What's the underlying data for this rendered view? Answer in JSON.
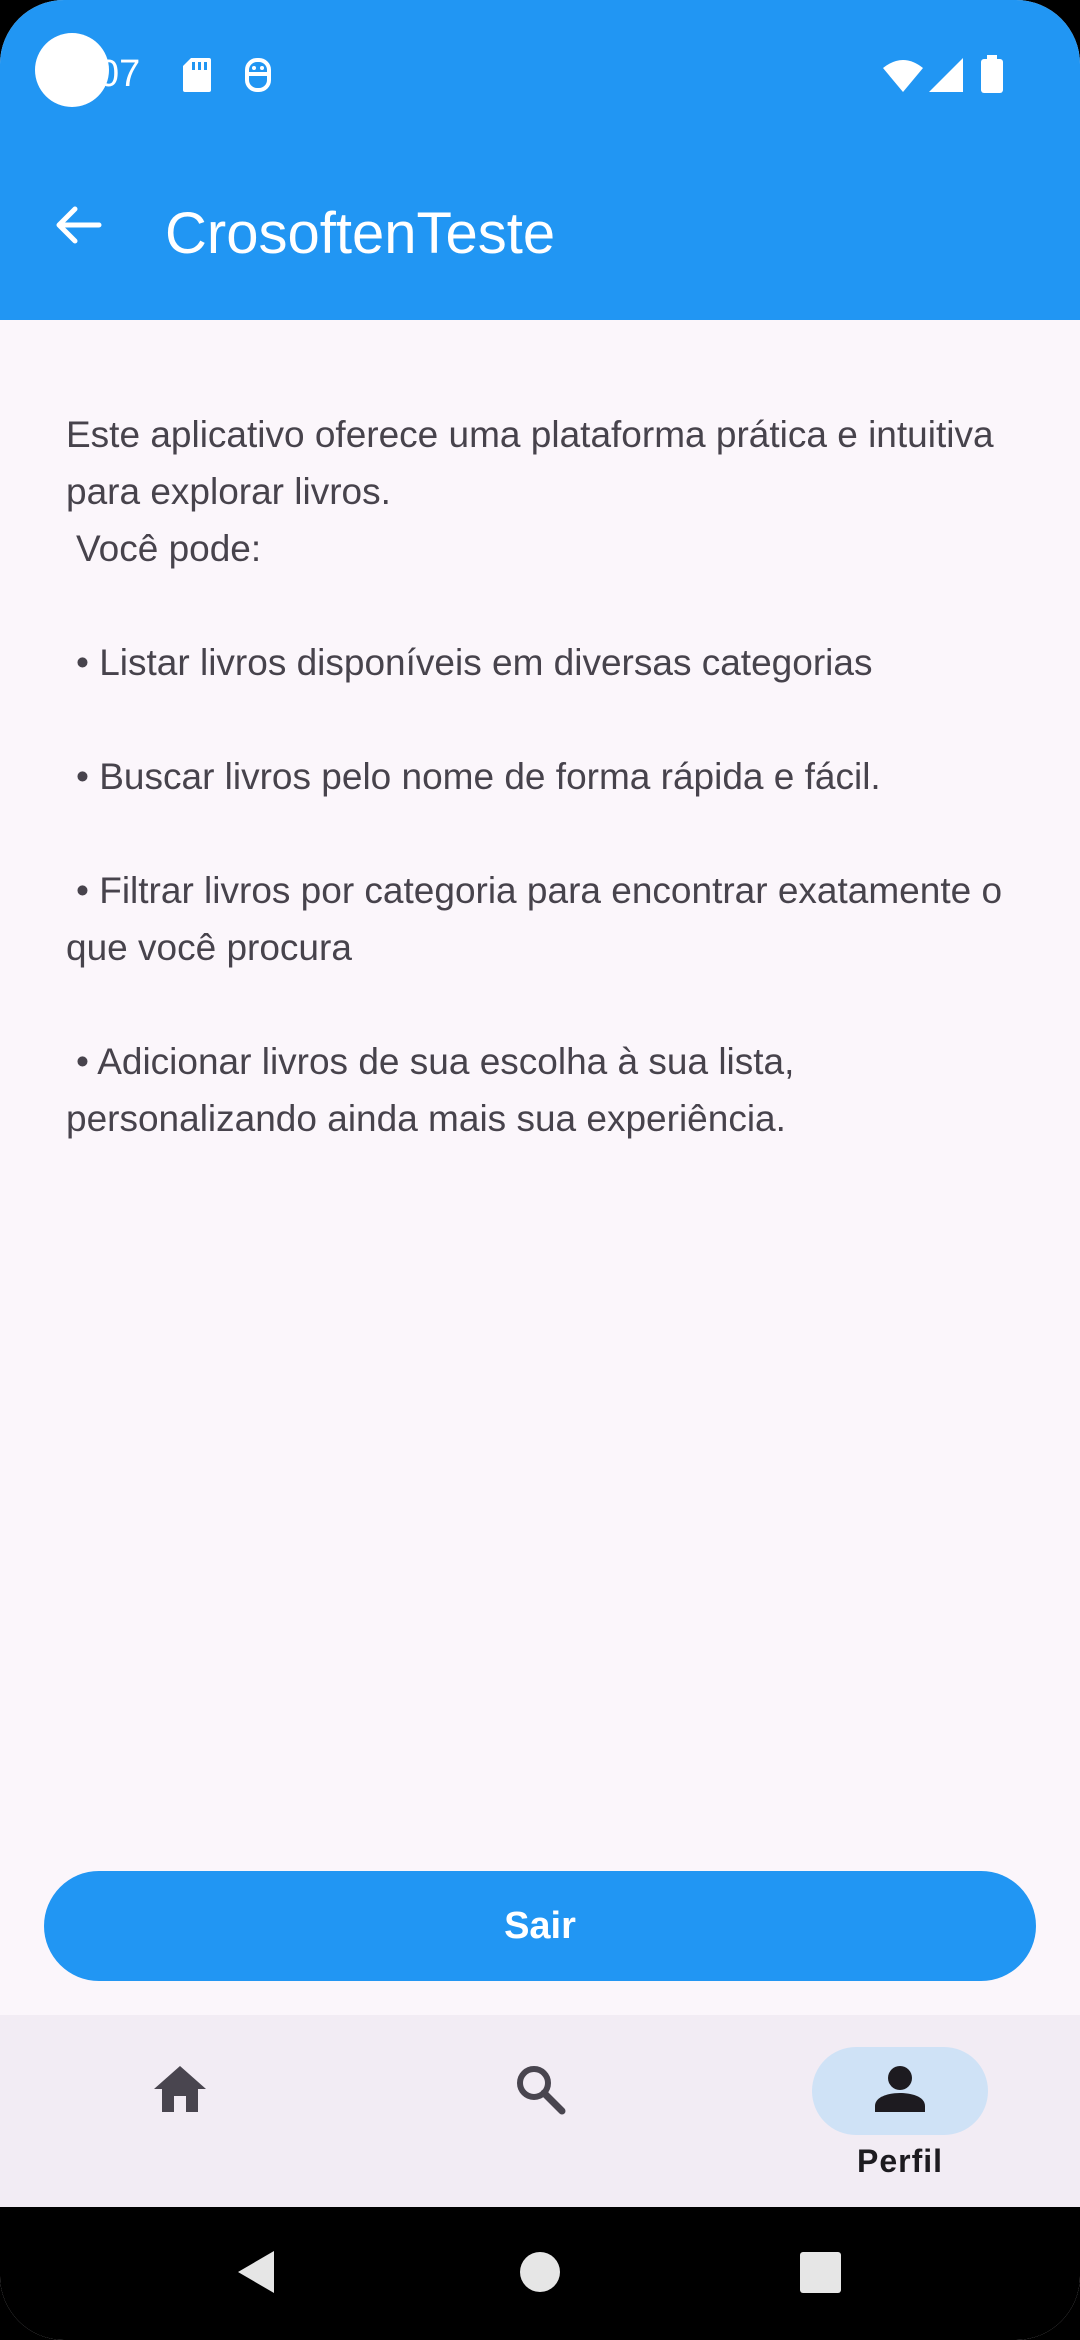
{
  "status_bar": {
    "time": "07",
    "icons": [
      "sd-card-icon",
      "android-debug-icon",
      "wifi-icon",
      "signal-icon",
      "battery-icon"
    ]
  },
  "app_bar": {
    "title": "CrosoftenTeste",
    "back_icon": "arrow-back-icon"
  },
  "content": {
    "intro_line1": "Este aplicativo oferece uma plataforma prática e intuitiva para explorar livros.",
    "intro_line2": "Você pode:",
    "features": [
      "• Listar livros disponíveis em diversas categorias",
      "• Buscar livros pelo nome de forma rápida e fácil.",
      "• Filtrar livros por categoria para encontrar exatamente o que você procura",
      "• Adicionar livros de sua escolha à sua lista, personalizando ainda mais sua experiência."
    ]
  },
  "actions": {
    "logout_label": "Sair"
  },
  "bottom_nav": {
    "items": [
      {
        "icon": "home-icon",
        "label": "",
        "active": false
      },
      {
        "icon": "search-icon",
        "label": "",
        "active": false
      },
      {
        "icon": "person-icon",
        "label": "Perfil",
        "active": true
      }
    ]
  },
  "system_nav": [
    "back-triangle-icon",
    "home-circle-icon",
    "recents-square-icon"
  ],
  "colors": {
    "primary": "#2196f3",
    "background": "#fbf6fb",
    "nav_background": "#f2ecf4",
    "active_indicator": "#cfe2f6",
    "body_text": "#47434c"
  }
}
